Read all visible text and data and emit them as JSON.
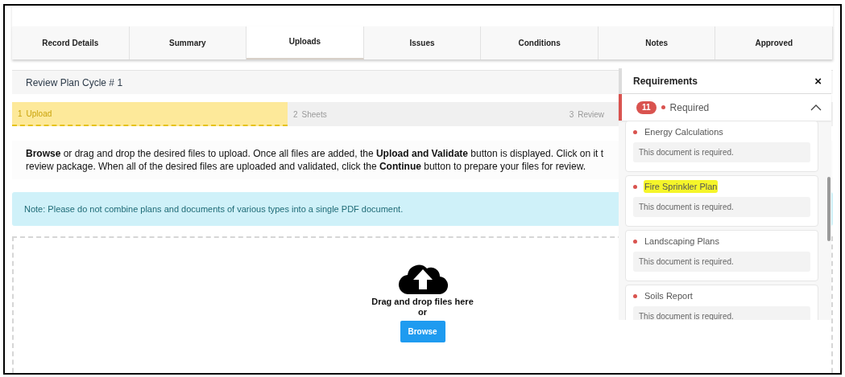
{
  "tabs": [
    {
      "label": "Record Details",
      "selected": false
    },
    {
      "label": "Summary",
      "selected": false
    },
    {
      "label": "Uploads",
      "selected": true
    },
    {
      "label": "Issues",
      "selected": false
    },
    {
      "label": "Conditions",
      "selected": false
    },
    {
      "label": "Notes",
      "selected": false
    },
    {
      "label": "Approved",
      "selected": false
    }
  ],
  "review": {
    "title": "Review Plan Cycle # 1"
  },
  "steps": [
    {
      "number": "1",
      "label": "Upload",
      "selected": true
    },
    {
      "number": "2",
      "label": "Sheets",
      "selected": false
    },
    {
      "number": "3",
      "label": "Review",
      "selected": false
    }
  ],
  "instructions": [
    "**Browse** or drag and drop the desired files to upload. Once all files are added, the **Upload and Validate** button is displayed. Click on it t",
    "review package. When all of the desired files are uploaded and validated, click the **Continue** button to prepare your files for review."
  ],
  "note": "Note: Please do not combine plans and documents of various types into a single PDF document.",
  "dropzone": {
    "text": "Drag and drop files here",
    "or": "or",
    "button": "Browse"
  },
  "requirements": {
    "title": "Requirements",
    "close": "×",
    "count": "11",
    "group": "Required",
    "expanded": true,
    "items": [
      {
        "name": "Energy Calculations",
        "message": "This document is required.",
        "highlighted": false
      },
      {
        "name": "Fire Sprinkler Plan",
        "message": "This document is required.",
        "highlighted": true
      },
      {
        "name": "Landscaping Plans",
        "message": "This document is required.",
        "highlighted": false
      },
      {
        "name": "Soils Report",
        "message": "This document is required.",
        "highlighted": false
      }
    ]
  }
}
